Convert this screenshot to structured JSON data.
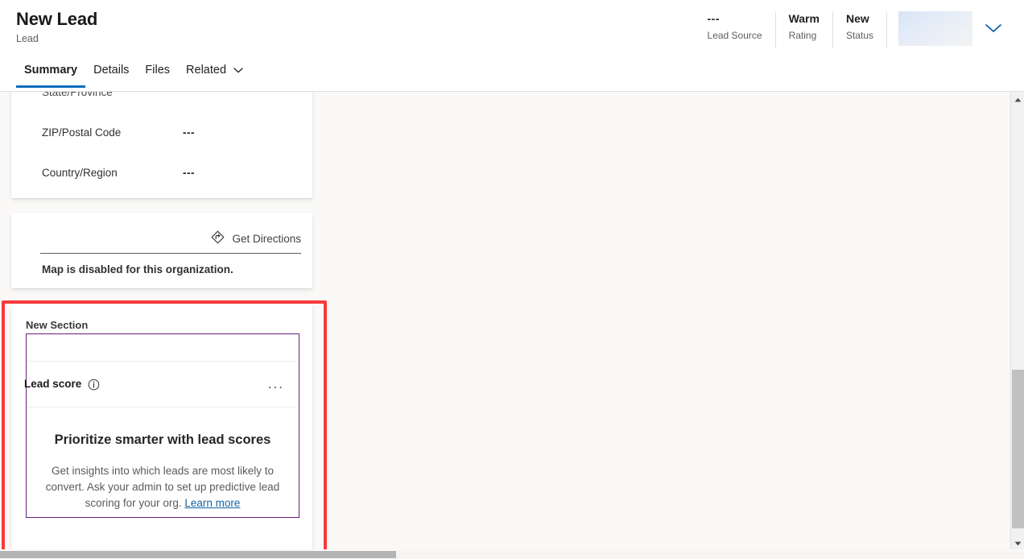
{
  "header": {
    "title": "New Lead",
    "subtitle": "Lead",
    "meta": [
      {
        "value": "---",
        "label": "Lead Source"
      },
      {
        "value": "Warm",
        "label": "Rating"
      },
      {
        "value": "New",
        "label": "Status"
      }
    ],
    "skeleton_placeholder": "",
    "chevron_icon": "chevron-down-icon"
  },
  "tabs": [
    {
      "label": "Summary",
      "active": true
    },
    {
      "label": "Details",
      "active": false
    },
    {
      "label": "Files",
      "active": false
    },
    {
      "label": "Related",
      "active": false,
      "has_chevron": true
    }
  ],
  "address_card": {
    "clipped_label": "State/Province",
    "rows": [
      {
        "label": "ZIP/Postal Code",
        "value": "---"
      },
      {
        "label": "Country/Region",
        "value": "---"
      }
    ]
  },
  "map_card": {
    "directions_label": "Get Directions",
    "directions_icon": "directions-diamond-icon",
    "disabled_message": "Map is disabled for this organization."
  },
  "section_card": {
    "section_label": "New Section",
    "lead_score": {
      "title": "Lead score",
      "info_icon": "info-circle-icon",
      "overflow_icon": "more-options-icon",
      "overflow_label": "...",
      "promo_title": "Prioritize smarter with lead scores",
      "promo_text": "Get insights into which leads are most likely to convert. Ask your admin to set up predictive lead scoring for your org. ",
      "promo_link": "Learn more"
    }
  },
  "scrollbars": {
    "vertical_up_icon": "scroll-up-arrow-icon",
    "vertical_down_icon": "scroll-down-arrow-icon"
  },
  "colors": {
    "accent_blue": "#0f6cbd",
    "highlight_red": "#f93a3a",
    "control_purple": "#68217a",
    "link_blue": "#1264a3",
    "canvas_bg": "#faf9f8"
  }
}
